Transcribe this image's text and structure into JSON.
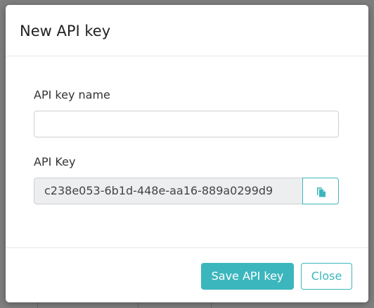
{
  "modal": {
    "title": "New API key"
  },
  "form": {
    "name_label": "API key name",
    "name_value": "",
    "name_placeholder": "",
    "key_label": "API Key",
    "key_value": "c238e053-6b1d-448e-aa16-889a0299d9"
  },
  "footer": {
    "save_label": "Save API key",
    "close_label": "Close"
  },
  "colors": {
    "accent": "#3cb6bd",
    "readonly_bg": "#eceef0"
  },
  "icons": {
    "copy": "copy-icon"
  }
}
